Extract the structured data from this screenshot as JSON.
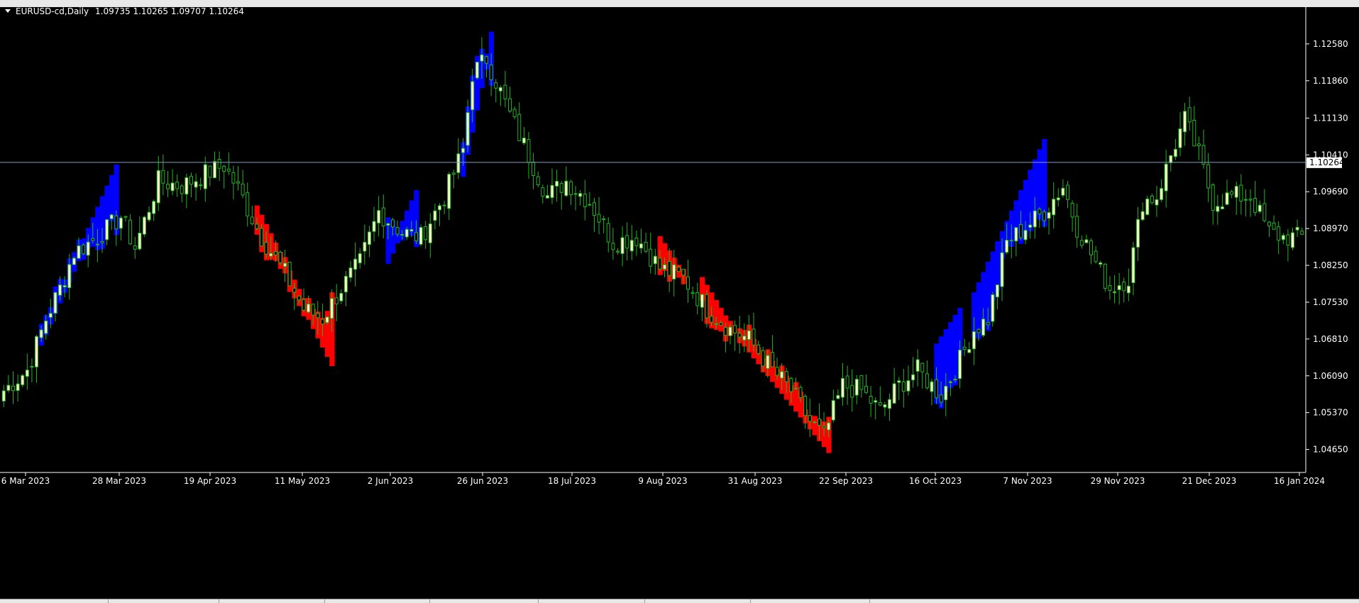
{
  "colors": {
    "background": "#000000",
    "foreground": "#ffffff",
    "candle_up_body": "#ffffcc",
    "candle_outline": "#22b522",
    "band_up": "#0000ff",
    "band_down": "#ff0000",
    "price_line": "#7f9fbf"
  },
  "header": {
    "symbol_label": "EURUSD-cd,Daily",
    "ohlc": "1.09735 1.10265 1.09707 1.10264"
  },
  "chart_data": {
    "type": "candlestick",
    "title": "EURUSD-cd,Daily",
    "x_tick_labels": [
      "6 Mar 2023",
      "28 Mar 2023",
      "19 Apr 2023",
      "11 May 2023",
      "2 Jun 2023",
      "26 Jun 2023",
      "18 Jul 2023",
      "9 Aug 2023",
      "31 Aug 2023",
      "22 Sep 2023",
      "16 Oct 2023",
      "7 Nov 2023",
      "29 Nov 2023",
      "21 Dec 2023",
      "16 Jan 2024"
    ],
    "y_tick_labels": [
      "1.12580",
      "1.11860",
      "1.11130",
      "1.10410",
      "1.09690",
      "1.08970",
      "1.08250",
      "1.07530",
      "1.06810",
      "1.06090",
      "1.05370",
      "1.04650"
    ],
    "ylim": [
      1.042,
      1.133
    ],
    "current_price": 1.10264,
    "current_price_label": "1.10264",
    "anchor_closes": [
      [
        0,
        1.058
      ],
      [
        5,
        1.062
      ],
      [
        9,
        1.072
      ],
      [
        12,
        1.078
      ],
      [
        15,
        1.085
      ],
      [
        20,
        1.088
      ],
      [
        25,
        1.092
      ],
      [
        28,
        1.086
      ],
      [
        33,
        1.099
      ],
      [
        38,
        1.098
      ],
      [
        42,
        1.1
      ],
      [
        47,
        1.102
      ],
      [
        50,
        1.0975
      ],
      [
        55,
        1.088
      ],
      [
        60,
        1.081
      ],
      [
        64,
        1.074
      ],
      [
        68,
        1.072
      ],
      [
        72,
        1.078
      ],
      [
        76,
        1.083
      ],
      [
        80,
        1.093
      ],
      [
        85,
        1.089
      ],
      [
        89,
        1.088
      ],
      [
        94,
        1.096
      ],
      [
        98,
        1.105
      ],
      [
        100,
        1.12
      ],
      [
        103,
        1.123
      ],
      [
        108,
        1.112
      ],
      [
        112,
        1.104
      ],
      [
        116,
        1.096
      ],
      [
        120,
        1.099
      ],
      [
        125,
        1.095
      ],
      [
        130,
        1.087
      ],
      [
        135,
        1.088
      ],
      [
        140,
        1.082
      ],
      [
        145,
        1.08
      ],
      [
        150,
        1.074
      ],
      [
        155,
        1.07
      ],
      [
        159,
        1.068
      ],
      [
        164,
        1.062
      ],
      [
        168,
        1.058
      ],
      [
        172,
        1.052
      ],
      [
        175,
        1.049
      ],
      [
        179,
        1.059
      ],
      [
        183,
        1.058
      ],
      [
        187,
        1.054
      ],
      [
        191,
        1.059
      ],
      [
        195,
        1.062
      ],
      [
        200,
        1.057
      ],
      [
        204,
        1.064
      ],
      [
        207,
        1.07
      ],
      [
        210,
        1.072
      ],
      [
        214,
        1.087
      ],
      [
        218,
        1.09
      ],
      [
        222,
        1.093
      ],
      [
        226,
        1.098
      ],
      [
        229,
        1.09
      ],
      [
        233,
        1.083
      ],
      [
        236,
        1.078
      ],
      [
        240,
        1.08
      ],
      [
        243,
        1.095
      ],
      [
        246,
        1.096
      ],
      [
        249,
        1.104
      ],
      [
        252,
        1.111
      ],
      [
        255,
        1.104
      ],
      [
        258,
        1.095
      ],
      [
        262,
        1.096
      ],
      [
        266,
        1.096
      ],
      [
        270,
        1.089
      ],
      [
        273,
        1.088
      ],
      [
        276,
        1.088
      ]
    ],
    "bands": [
      {
        "name": "",
        "direction": "up",
        "start": 8,
        "end": 24,
        "from": 1.068,
        "to": 1.101
      },
      {
        "name": "",
        "direction": "down",
        "start": 54,
        "end": 70,
        "from": 1.093,
        "to": 1.064
      },
      {
        "name": "",
        "direction": "up",
        "start": 82,
        "end": 88,
        "from": 1.084,
        "to": 1.096
      },
      {
        "name": "",
        "direction": "up",
        "start": 98,
        "end": 104,
        "from": 1.101,
        "to": 1.127
      },
      {
        "name": "",
        "direction": "down",
        "start": 140,
        "end": 145,
        "from": 1.087,
        "to": 1.08
      },
      {
        "name": "",
        "direction": "down",
        "start": 149,
        "end": 155,
        "from": 1.079,
        "to": 1.07
      },
      {
        "name": "",
        "direction": "down",
        "start": 157,
        "end": 176,
        "from": 1.069,
        "to": 1.047
      },
      {
        "name": "",
        "direction": "up",
        "start": 199,
        "end": 204,
        "from": 1.066,
        "to": 1.073
      },
      {
        "name": "",
        "direction": "up",
        "start": 207,
        "end": 222,
        "from": 1.076,
        "to": 1.106
      }
    ]
  }
}
